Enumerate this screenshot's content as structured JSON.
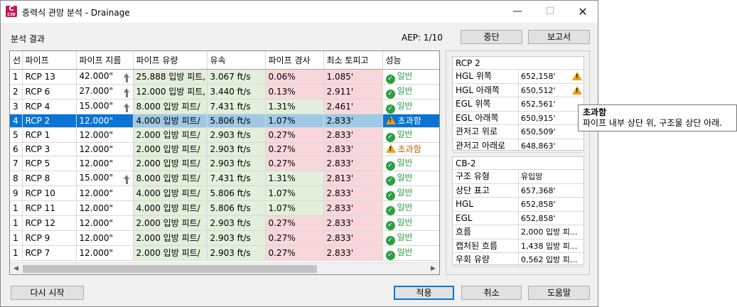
{
  "window": {
    "title": "중력식 관망 분석 - Drainage",
    "app_icon": "civil3d-app-icon"
  },
  "header": {
    "section_label": "분석 결과",
    "aep": "AEP: 1/10",
    "stop_label": "중단",
    "report_label": "보고서"
  },
  "table": {
    "columns": [
      "선",
      "파이프",
      "파이프 지름",
      "파이프 유량",
      "유속",
      "파이프 경사",
      "최소 토피고",
      "성능"
    ],
    "rows": [
      {
        "idx": "1",
        "pipe": "RCP 13",
        "diameter": "42.000\"",
        "flow": "25.888 입방 피트,",
        "velocity": "3.067 ft/s",
        "slope": "0.06%",
        "cover": "1.085'",
        "perf": "일반",
        "status": "ok",
        "arrow": true,
        "slope_red": true,
        "selected": false
      },
      {
        "idx": "2",
        "pipe": "RCP 6",
        "diameter": "27.000\"",
        "flow": "12.000 입방 피트,",
        "velocity": "3.440 ft/s",
        "slope": "0.13%",
        "cover": "2.911'",
        "perf": "일반",
        "status": "ok",
        "arrow": true,
        "slope_red": true,
        "selected": false
      },
      {
        "idx": "3",
        "pipe": "RCP 4",
        "diameter": "15.000\"",
        "flow": "8.000 입방 피트/",
        "velocity": "7.431 ft/s",
        "slope": "1.31%",
        "cover": "2.461'",
        "perf": "일반",
        "status": "ok",
        "arrow": true,
        "slope_red": false,
        "selected": false
      },
      {
        "idx": "4",
        "pipe": "RCP 2",
        "diameter": "12.000\"",
        "flow": "4.000 입방 피트/",
        "velocity": "5.806 ft/s",
        "slope": "1.07%",
        "cover": "2.833'",
        "perf": "초과함",
        "status": "warn",
        "arrow": false,
        "slope_red": false,
        "selected": true
      },
      {
        "idx": "5",
        "pipe": "RCP 1",
        "diameter": "12.000\"",
        "flow": "2.000 입방 피트/",
        "velocity": "2.903 ft/s",
        "slope": "0.27%",
        "cover": "2.833'",
        "perf": "일반",
        "status": "ok",
        "arrow": false,
        "slope_red": true,
        "selected": false
      },
      {
        "idx": "6",
        "pipe": "RCP 3",
        "diameter": "12.000\"",
        "flow": "2.000 입방 피트/",
        "velocity": "2.903 ft/s",
        "slope": "0.27%",
        "cover": "2.833'",
        "perf": "초과함",
        "status": "warn",
        "arrow": false,
        "slope_red": true,
        "selected": false
      },
      {
        "idx": "7",
        "pipe": "RCP 5",
        "diameter": "12.000\"",
        "flow": "2.000 입방 피트/",
        "velocity": "2.903 ft/s",
        "slope": "0.27%",
        "cover": "2.833'",
        "perf": "일반",
        "status": "ok",
        "arrow": false,
        "slope_red": true,
        "selected": false
      },
      {
        "idx": "8",
        "pipe": "RCP 8",
        "diameter": "15.000\"",
        "flow": "8.000 입방 피트/",
        "velocity": "7.431 ft/s",
        "slope": "1.31%",
        "cover": "2.813'",
        "perf": "일반",
        "status": "ok",
        "arrow": true,
        "slope_red": false,
        "selected": false
      },
      {
        "idx": "9",
        "pipe": "RCP 10",
        "diameter": "12.000\"",
        "flow": "4.000 입방 피트/",
        "velocity": "5.806 ft/s",
        "slope": "1.07%",
        "cover": "2.833'",
        "perf": "일반",
        "status": "ok",
        "arrow": false,
        "slope_red": false,
        "selected": false
      },
      {
        "idx": "1",
        "pipe": "RCP 11",
        "diameter": "12.000\"",
        "flow": "4.000 입방 피트/",
        "velocity": "5.806 ft/s",
        "slope": "1.07%",
        "cover": "2.833'",
        "perf": "일반",
        "status": "ok",
        "arrow": false,
        "slope_red": false,
        "selected": false
      },
      {
        "idx": "1",
        "pipe": "RCP 12",
        "diameter": "12.000\"",
        "flow": "2.000 입방 피트/",
        "velocity": "2.903 ft/s",
        "slope": "0.27%",
        "cover": "2.833'",
        "perf": "일반",
        "status": "ok",
        "arrow": false,
        "slope_red": true,
        "selected": false
      },
      {
        "idx": "1",
        "pipe": "RCP 9",
        "diameter": "12.000\"",
        "flow": "2.000 입방 피트/",
        "velocity": "2.903 ft/s",
        "slope": "0.27%",
        "cover": "2.833'",
        "perf": "일반",
        "status": "ok",
        "arrow": false,
        "slope_red": true,
        "selected": false
      },
      {
        "idx": "1",
        "pipe": "RCP 7",
        "diameter": "12.000\"",
        "flow": "2.000 입방 피트/",
        "velocity": "2.903 ft/s",
        "slope": "0.27%",
        "cover": "2.833'",
        "perf": "일반",
        "status": "ok",
        "arrow": false,
        "slope_red": true,
        "selected": false
      }
    ]
  },
  "props_pipe": {
    "title": "RCP 2",
    "rows": [
      {
        "key": "HGL 위쪽",
        "value": "652,158'",
        "warn": true
      },
      {
        "key": "HGL 아래쪽",
        "value": "650,512'",
        "warn": true
      },
      {
        "key": "EGL 위쪽",
        "value": "652,561'",
        "warn": false
      },
      {
        "key": "EGL 아래쪽",
        "value": "650,915'",
        "warn": false
      },
      {
        "key": "관저고 위로",
        "value": "650,509'",
        "warn": false
      },
      {
        "key": "관저고 아래로",
        "value": "648,863'",
        "warn": false
      }
    ]
  },
  "props_structure": {
    "title": "CB-2",
    "rows": [
      {
        "key": "구조 유형",
        "value": "유입망"
      },
      {
        "key": "상단 표고",
        "value": "657,368'"
      },
      {
        "key": "HGL",
        "value": "652,858'"
      },
      {
        "key": "EGL",
        "value": "652,858'"
      },
      {
        "key": "흐름",
        "value": "2,000 입방 피..."
      },
      {
        "key": "캡처된 흐름",
        "value": "1,438 입방 피..."
      },
      {
        "key": "우회 유량",
        "value": "0,562 입방 피..."
      }
    ]
  },
  "tooltip": {
    "title": "초과함",
    "text": "파이프 내부 상단 위, 구조물 상단 아래."
  },
  "footer": {
    "restart_label": "다시 시작",
    "apply_label": "적용",
    "cancel_label": "취소",
    "help_label": "도움말"
  },
  "colors": {
    "selection": "#0a74d4",
    "ok": "#2e9e44",
    "warn": "#e8a317",
    "green_cell": "#e2efda",
    "red_cell": "#f8d7da"
  }
}
